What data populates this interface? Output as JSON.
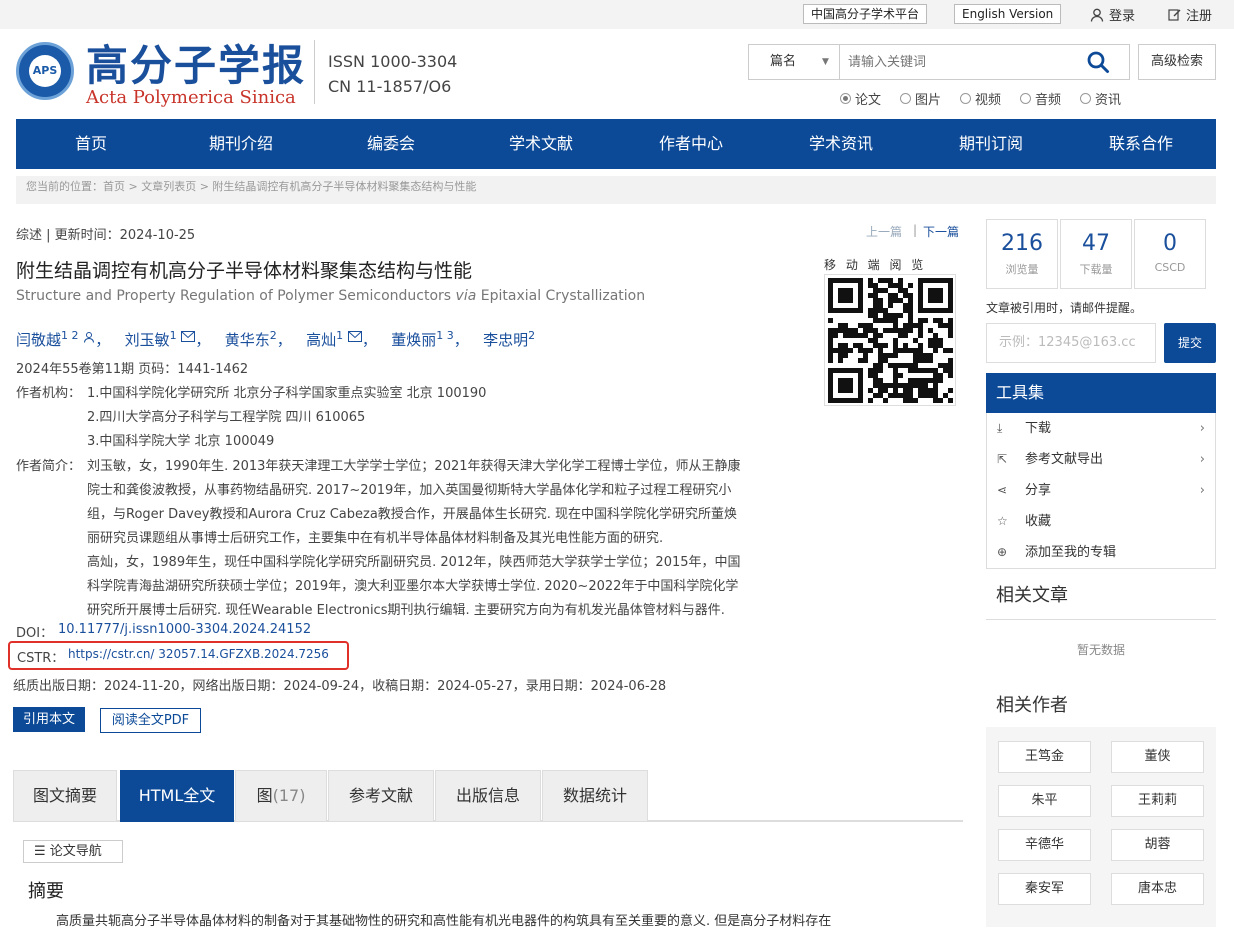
{
  "topbar": {
    "platform": "中国高分子学术平台",
    "english": "English Version",
    "login": "登录",
    "register": "注册"
  },
  "logo": {
    "emblem": "APS",
    "cn": "高分子学报",
    "en": "Acta Polymerica Sinica"
  },
  "issn": {
    "issn": "ISSN  1000-3304",
    "cn": "CN  11-1857/O6"
  },
  "search": {
    "select": "篇名",
    "placeholder": "请输入关键词",
    "advanced": "高级检索",
    "types": [
      "论文",
      "图片",
      "视频",
      "音频",
      "资讯"
    ],
    "selected_type": "论文"
  },
  "nav": [
    "首页",
    "期刊介绍",
    "编委会",
    "学术文献",
    "作者中心",
    "学术资讯",
    "期刊订阅",
    "联系合作"
  ],
  "breadcrumb": "您当前的位置：首页 > 文章列表页 > 附生结晶调控有机高分子半导体材料聚集态结构与性能",
  "article": {
    "meta": "综述 | 更新时间：2024-10-25",
    "prev": "上一篇",
    "next": "下一篇",
    "title": "附生结晶调控有机高分子半导体材料聚集态结构与性能",
    "title_en_a": "Structure and Property Regulation of Polymer Semiconductors ",
    "title_en_via": "via",
    "title_en_b": " Epitaxial Crystallization",
    "authors": [
      {
        "name": "闫敬越",
        "sup": "1 2",
        "icon": "person-icon"
      },
      {
        "name": "刘玉敏",
        "sup": "1",
        "icon": "mail-icon"
      },
      {
        "name": "黄华东",
        "sup": "2",
        "icon": ""
      },
      {
        "name": "高灿",
        "sup": "1",
        "icon": "mail-icon"
      },
      {
        "name": "董焕丽",
        "sup": "1 3",
        "icon": ""
      },
      {
        "name": "李忠明",
        "sup": "2",
        "icon": ""
      }
    ],
    "volume": "2024年55卷第11期 页码：1441-1462",
    "aff_label": "作者机构：",
    "affiliations": [
      "1.中国科学院化学研究所 北京分子科学国家重点实验室 北京 100190",
      "2.四川大学高分子科学与工程学院 四川 610065",
      "3.中国科学院大学 北京 100049"
    ],
    "bio_label": "作者简介：",
    "bio_lines": [
      "刘玉敏，女，1990年生. 2013年获天津理工大学学士学位；2021年获得天津大学化学工程博士学位，师从王静康",
      "院士和龚俊波教授，从事药物结晶研究. 2017~2019年，加入英国曼彻斯特大学晶体化学和粒子过程工程研究小",
      "组，与Roger Davey教授和Aurora Cruz Cabeza教授合作，开展晶体生长研究. 现在中国科学院化学研究所董焕",
      "丽研究员课题组从事博士后研究工作，主要集中在有机半导体晶体材料制备及其光电性能方面的研究.",
      "高灿，女，1989年生，现任中国科学院化学研究所副研究员. 2012年，陕西师范大学获学士学位；2015年，中国",
      "科学院青海盐湖研究所获硕士学位；2019年，澳大利亚墨尔本大学获博士学位. 2020~2022年于中国科学院化学",
      "研究所开展博士后研究. 现任Wearable Electronics期刊执行编辑. 主要研究方向为有机发光晶体管材料与器件."
    ],
    "doi_label": "DOI：",
    "doi": "10.11777/j.issn1000-3304.2024.24152",
    "cstr_label": "CSTR：",
    "cstr": "https://cstr.cn/ 32057.14.GFZXB.2024.7256",
    "dates": "纸质出版日期：2024-11-20，网络出版日期：2024-09-24，收稿日期：2024-05-27，录用日期：2024-06-28",
    "cite_btn": "引用本文",
    "pdf_btn": "阅读全文PDF",
    "qr_caption": "移 动 端 阅 览"
  },
  "stats": [
    {
      "value": "216",
      "label": "浏览量"
    },
    {
      "value": "47",
      "label": "下载量"
    },
    {
      "value": "0",
      "label": "CSCD"
    }
  ],
  "cite_notice": "文章被引用时，请邮件提醒。",
  "email": {
    "placeholder": "示例：12345@163.cc",
    "submit": "提交"
  },
  "tools": {
    "title": "工具集",
    "items": [
      {
        "label": "下载",
        "icon": "download-icon",
        "arrow": true
      },
      {
        "label": "参考文献导出",
        "icon": "export-icon",
        "arrow": true
      },
      {
        "label": "分享",
        "icon": "share-icon",
        "arrow": true
      },
      {
        "label": "收藏",
        "icon": "star-icon",
        "arrow": false
      },
      {
        "label": "添加至我的专辑",
        "icon": "add-circle-icon",
        "arrow": false
      }
    ]
  },
  "related_articles": {
    "title": "相关文章",
    "empty": "暂无数据"
  },
  "related_authors": {
    "title": "相关作者",
    "names": [
      "王笃金",
      "董侠",
      "朱平",
      "王莉莉",
      "辛德华",
      "胡蓉",
      "秦安军",
      "唐本忠"
    ]
  },
  "tabs": [
    {
      "label": "图文摘要"
    },
    {
      "label": "HTML全文",
      "active": true
    },
    {
      "label": "图",
      "count": "17"
    },
    {
      "label": "参考文献"
    },
    {
      "label": "出版信息"
    },
    {
      "label": "数据统计"
    }
  ],
  "fulltext": {
    "nav_btn": "论文导航",
    "abstract_title": "摘要",
    "abstract_text": "高质量共轭高分子半导体晶体材料的制备对于其基础物性的研究和高性能有机光电器件的构筑具有至关重要的意义. 但是高分子材料存在"
  },
  "colors": {
    "primary": "#0c4a98",
    "cstr_highlight": "#e0302a",
    "logo_red": "#c8342a"
  }
}
